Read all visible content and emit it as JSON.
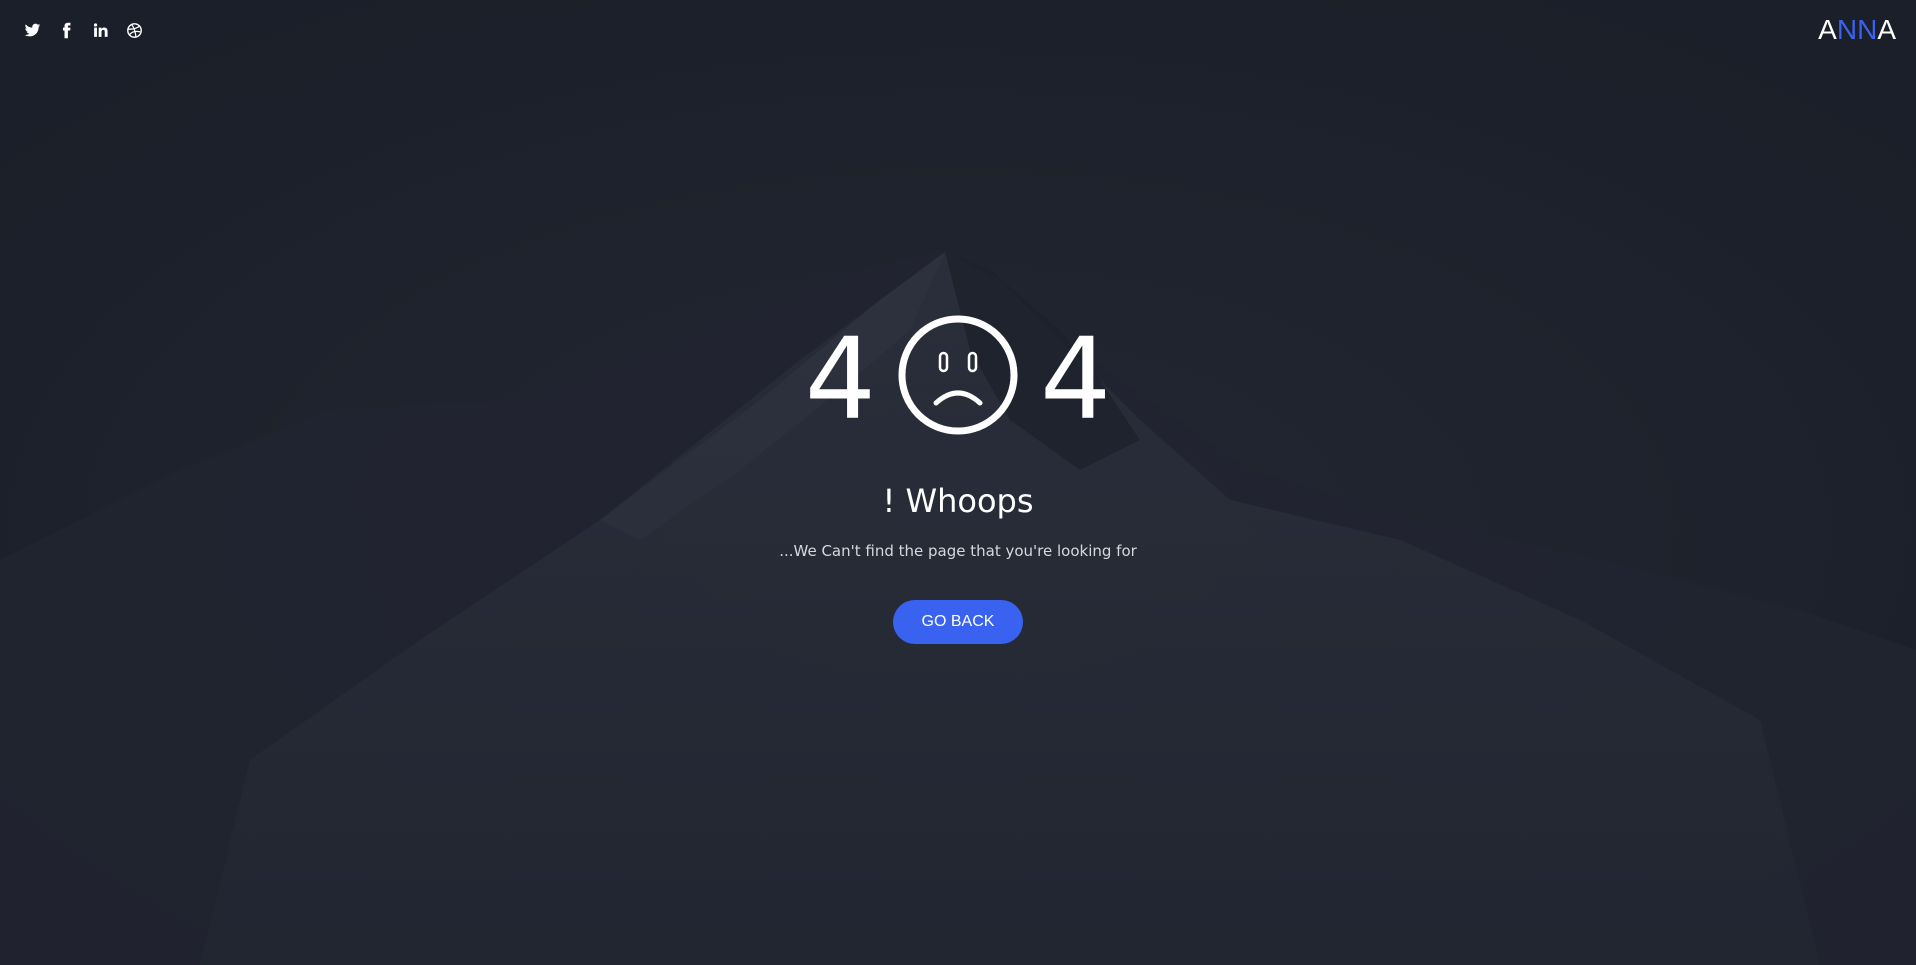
{
  "social": [
    {
      "name": "twitter-icon"
    },
    {
      "name": "facebook-icon"
    },
    {
      "name": "linkedin-icon"
    },
    {
      "name": "dribbble-icon"
    }
  ],
  "logo": {
    "letters": [
      "A",
      "N",
      "N",
      "A"
    ],
    "colors": [
      "#ffffff",
      "#3a62f0",
      "#3a62f0",
      "#ffffff"
    ]
  },
  "error": {
    "digit_left": "4",
    "digit_right": "4",
    "face_icon": "sad-face-icon",
    "headline": "! Whoops",
    "message": "...We Can't find the page that you're looking for",
    "button_label": "GO BACK"
  },
  "colors": {
    "background": "#1c202a",
    "accent": "#3a62f0",
    "text": "#ffffff"
  }
}
